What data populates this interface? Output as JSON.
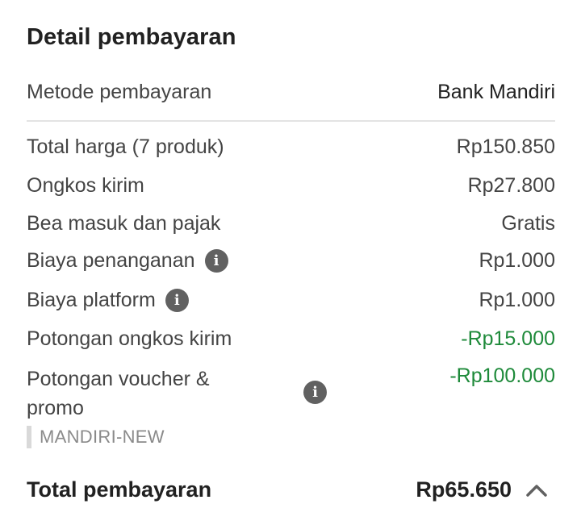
{
  "title": "Detail pembayaran",
  "payment_method": {
    "label": "Metode pembayaran",
    "value": "Bank Mandiri"
  },
  "rows": [
    {
      "label": "Total harga (7 produk)",
      "value": "Rp150.850"
    },
    {
      "label": "Ongkos kirim",
      "value": "Rp27.800"
    },
    {
      "label": "Bea masuk dan pajak",
      "value": "Gratis"
    },
    {
      "label": "Biaya penanganan",
      "value": "Rp1.000"
    },
    {
      "label": "Biaya platform",
      "value": "Rp1.000"
    },
    {
      "label": "Potongan ongkos kirim",
      "value": "-Rp15.000"
    }
  ],
  "voucher": {
    "label": "Potongan voucher & promo",
    "value": "-Rp100.000",
    "code": "MANDIRI-NEW"
  },
  "total": {
    "label": "Total pembayaran",
    "value": "Rp65.650"
  },
  "colors": {
    "discount": "#1e8a3a",
    "text": "#212121",
    "muted": "#444444",
    "icon": "#616161"
  },
  "icons": {
    "info": "info-icon",
    "collapse": "chevron-up-icon"
  }
}
